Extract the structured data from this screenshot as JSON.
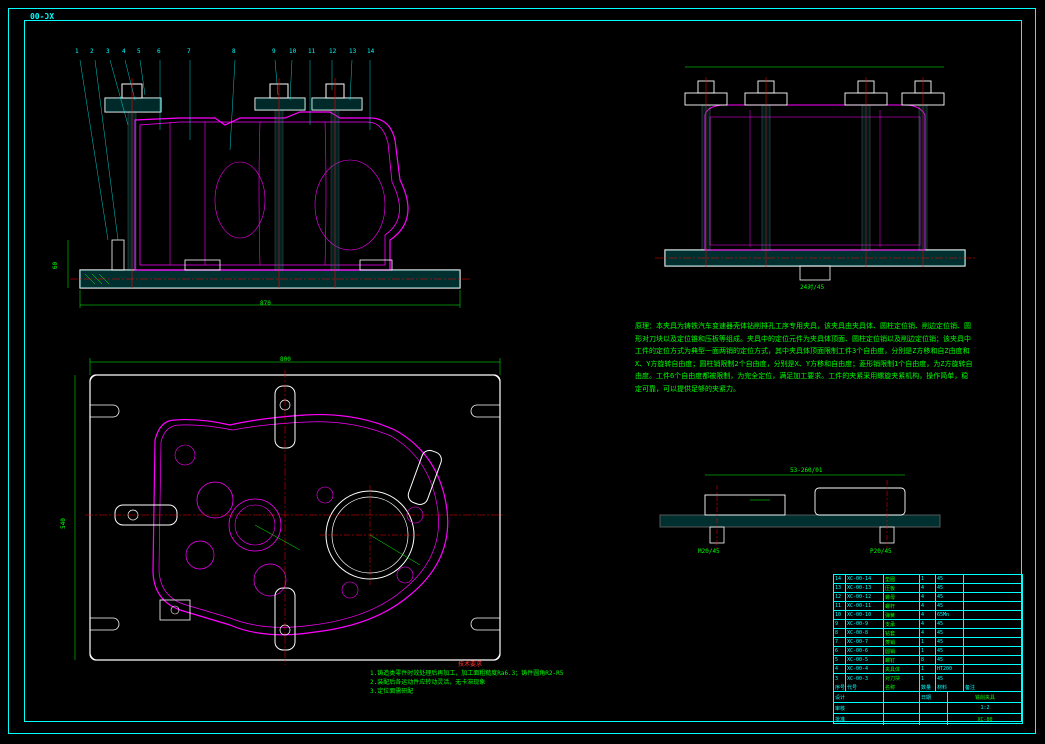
{
  "meta": {
    "corner_tl": "XC-00",
    "corner_br": "XC-00"
  },
  "leaders": [
    "1",
    "2",
    "3",
    "4",
    "5",
    "6",
    "7",
    "8",
    "9",
    "10",
    "11",
    "12",
    "13",
    "14"
  ],
  "dimensions": {
    "front_width": "870",
    "front_height": "60",
    "top_width": "800",
    "top_height": "540",
    "right_note1": "24对/45",
    "right_note2": "53-260/01",
    "right_dim1": "M20/45",
    "right_dim2": "P20/45"
  },
  "description_title": "原理：",
  "description": "本夹具为铸铁汽车变速器壳体钻削排孔工序专用夹具，该夹具由夹具体、圆柱定位销、削边定位销、圆形对刀块以及定位锥和压板等组成。夹具中的定位元件为夹具体顶面、圆柱定位销以及削边定位销；该夹具中工件的定位方式为典型一面两销的定位方式，其中夹具体顶面限制工件3个自由度，分别是Z方移和自Z由度和X、Y方旋转自由度；圆柱销限制2个自由度，分别是X、Y方移和自由度；菱形销限制1个自由度，为Z方旋转自由度。工件6个自由度都被限制，为完全定位，满足加工要求。工件的夹紧采用螺旋夹紧机构，操作简单，稳定可靠，可以提供足够的夹紧力。",
  "tech_req_title": "技术要求",
  "tech_req": "1.铸造类零件时效处理后再加工，加工面粗糙度Ra6.3；铸件圆角R2-R5\n2.装配后各运动件应转动灵活，无卡滞现象\n3.定位面需研配",
  "bom": [
    {
      "no": "14",
      "code": "XC-00-14",
      "name": "垫圈",
      "qty": "1",
      "mat": "45",
      "note": ""
    },
    {
      "no": "13",
      "code": "XC-00-13",
      "name": "压板",
      "qty": "4",
      "mat": "45",
      "note": ""
    },
    {
      "no": "12",
      "code": "XC-00-12",
      "name": "螺母",
      "qty": "4",
      "mat": "45",
      "note": ""
    },
    {
      "no": "11",
      "code": "XC-00-11",
      "name": "螺杆",
      "qty": "4",
      "mat": "45",
      "note": ""
    },
    {
      "no": "10",
      "code": "XC-00-10",
      "name": "弹簧",
      "qty": "4",
      "mat": "65Mn",
      "note": ""
    },
    {
      "no": "9",
      "code": "XC-00-9",
      "name": "支承",
      "qty": "4",
      "mat": "45",
      "note": ""
    },
    {
      "no": "8",
      "code": "XC-00-8",
      "name": "钻套",
      "qty": "4",
      "mat": "45",
      "note": ""
    },
    {
      "no": "7",
      "code": "XC-00-7",
      "name": "菱销",
      "qty": "1",
      "mat": "45",
      "note": ""
    },
    {
      "no": "6",
      "code": "XC-00-6",
      "name": "圆销",
      "qty": "1",
      "mat": "45",
      "note": ""
    },
    {
      "no": "5",
      "code": "XC-00-5",
      "name": "螺钉",
      "qty": "8",
      "mat": "45",
      "note": ""
    },
    {
      "no": "4",
      "code": "XC-00-4",
      "name": "夹具体",
      "qty": "1",
      "mat": "HT200",
      "note": ""
    },
    {
      "no": "3",
      "code": "XC-00-3",
      "name": "对刀块",
      "qty": "1",
      "mat": "45",
      "note": ""
    }
  ],
  "bom_header": {
    "c1": "序号",
    "c2": "代号",
    "c3": "名称",
    "c4": "数量",
    "c5": "材料",
    "c6": "备注"
  },
  "title_info": {
    "drawn": "设计",
    "check": "审核",
    "appr": "批准",
    "date": "日期",
    "title": "铣削夹具",
    "scale": "1:2",
    "dwg_no": "XC-00",
    "sheet": "共1张 第1张"
  }
}
